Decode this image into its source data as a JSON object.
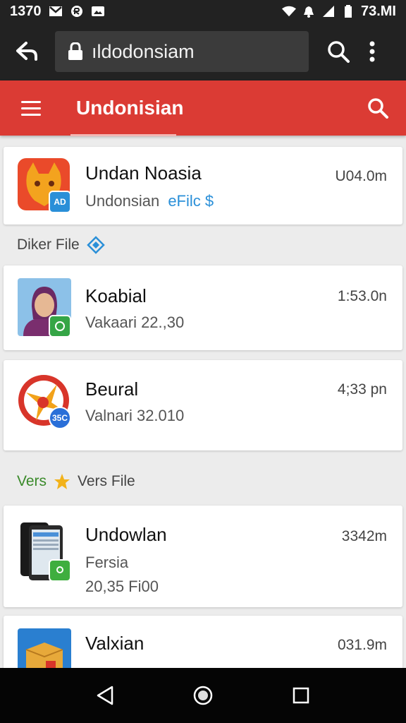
{
  "status": {
    "time": "1370",
    "right_text": "73.MI"
  },
  "browser": {
    "url": "ıldodonsiam"
  },
  "header": {
    "title": "Undonisian"
  },
  "items": [
    {
      "title": "Undan Noasia",
      "subtitle": "Undonsian",
      "link": "eFilc $",
      "time": "U04.0m",
      "badge": "AD"
    },
    {
      "title": "Koabial",
      "subtitle": "Vakaari 22.,30",
      "time": "1:53.0n"
    },
    {
      "title": "Beural",
      "subtitle": "Valnari 32.010",
      "time": "4;33 pn",
      "badge": "35C"
    },
    {
      "title": "Undowlan",
      "subtitle": "Fersia",
      "subtitle2": "20,35 Fi00",
      "time": "3342m"
    },
    {
      "title": "Valxian",
      "time": "031.9m"
    }
  ],
  "sections": {
    "diker": "Diker File",
    "vers_a": "Vers",
    "vers_b": "Vers File"
  },
  "colors": {
    "header": "#db3b34",
    "status": "#222222",
    "nav": "#050505",
    "accent": "#2a8fd8"
  }
}
